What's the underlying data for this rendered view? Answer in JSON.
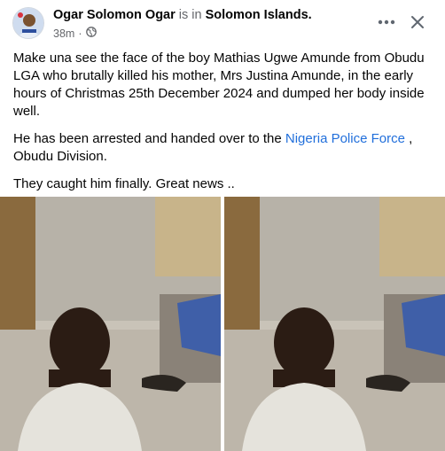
{
  "post": {
    "author": "Ogar Solomon Ogar",
    "is_in": "is in",
    "location": "Solomon Islands.",
    "time": "38m",
    "separator": "·",
    "text_paragraph_1": "Make una see the face of the boy Mathias Ugwe Amunde from Obudu LGA who brutally killed his mother, Mrs Justina Amunde, in the early hours of Christmas 25th December 2024 and dumped her body inside well.",
    "text_paragraph_2_before": "He has been arrested and handed over to the ",
    "text_paragraph_2_link": "Nigeria Police Force",
    "text_paragraph_2_after": " , Obudu Division.",
    "text_paragraph_3": "They caught him finally. Great news .."
  },
  "icons": {
    "privacy": "globe-icon",
    "more": "more-options-icon",
    "close": "close-icon"
  },
  "colors": {
    "link": "#216fdb",
    "muted": "#65676b",
    "text": "#050505"
  }
}
